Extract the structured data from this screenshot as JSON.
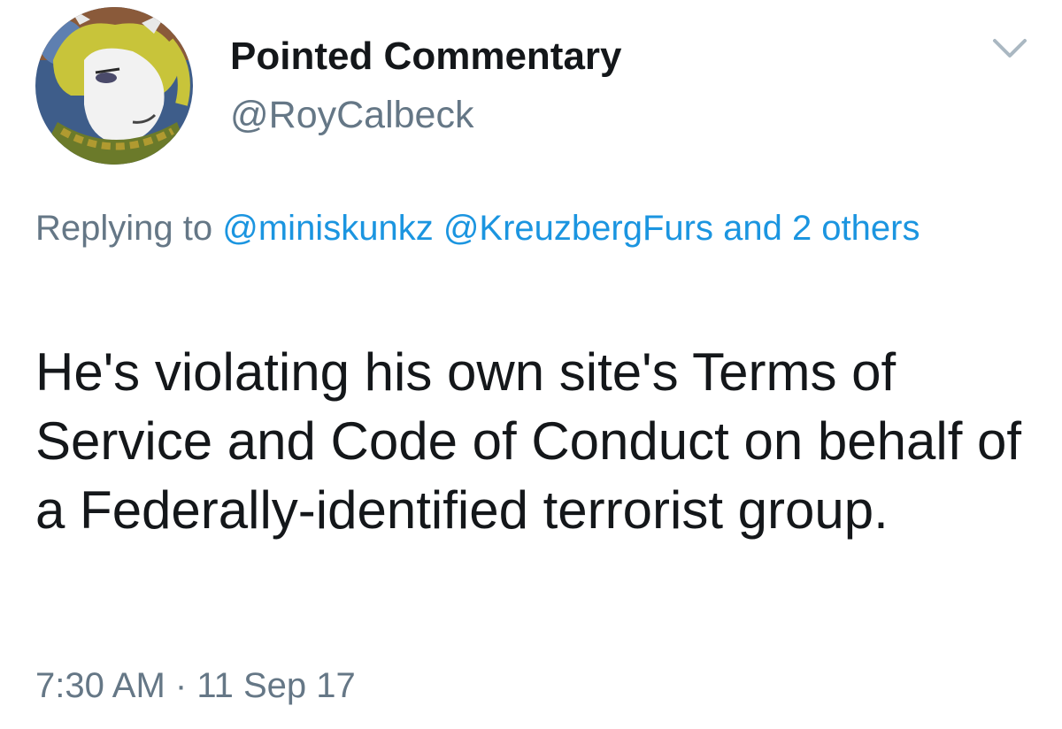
{
  "tweet": {
    "author": {
      "display_name": "Pointed Commentary",
      "handle": "@RoyCalbeck"
    },
    "reply_context": {
      "prefix": "Replying to",
      "mentions": [
        "@miniskunkz",
        "@KreuzbergFurs"
      ],
      "others": "and 2 others"
    },
    "text": "He's violating his own site's Terms of Service and Code of Conduct on behalf of a Federally-identified terrorist group.",
    "time": "7:30 AM",
    "separator": "·",
    "date": "11 Sep 17"
  },
  "icons": {
    "more_menu": "chevron-down-icon",
    "avatar": "furry-character-avatar"
  },
  "colors": {
    "text_primary": "#14171a",
    "text_secondary": "#657786",
    "link": "#1b95e0",
    "background": "#ffffff"
  }
}
